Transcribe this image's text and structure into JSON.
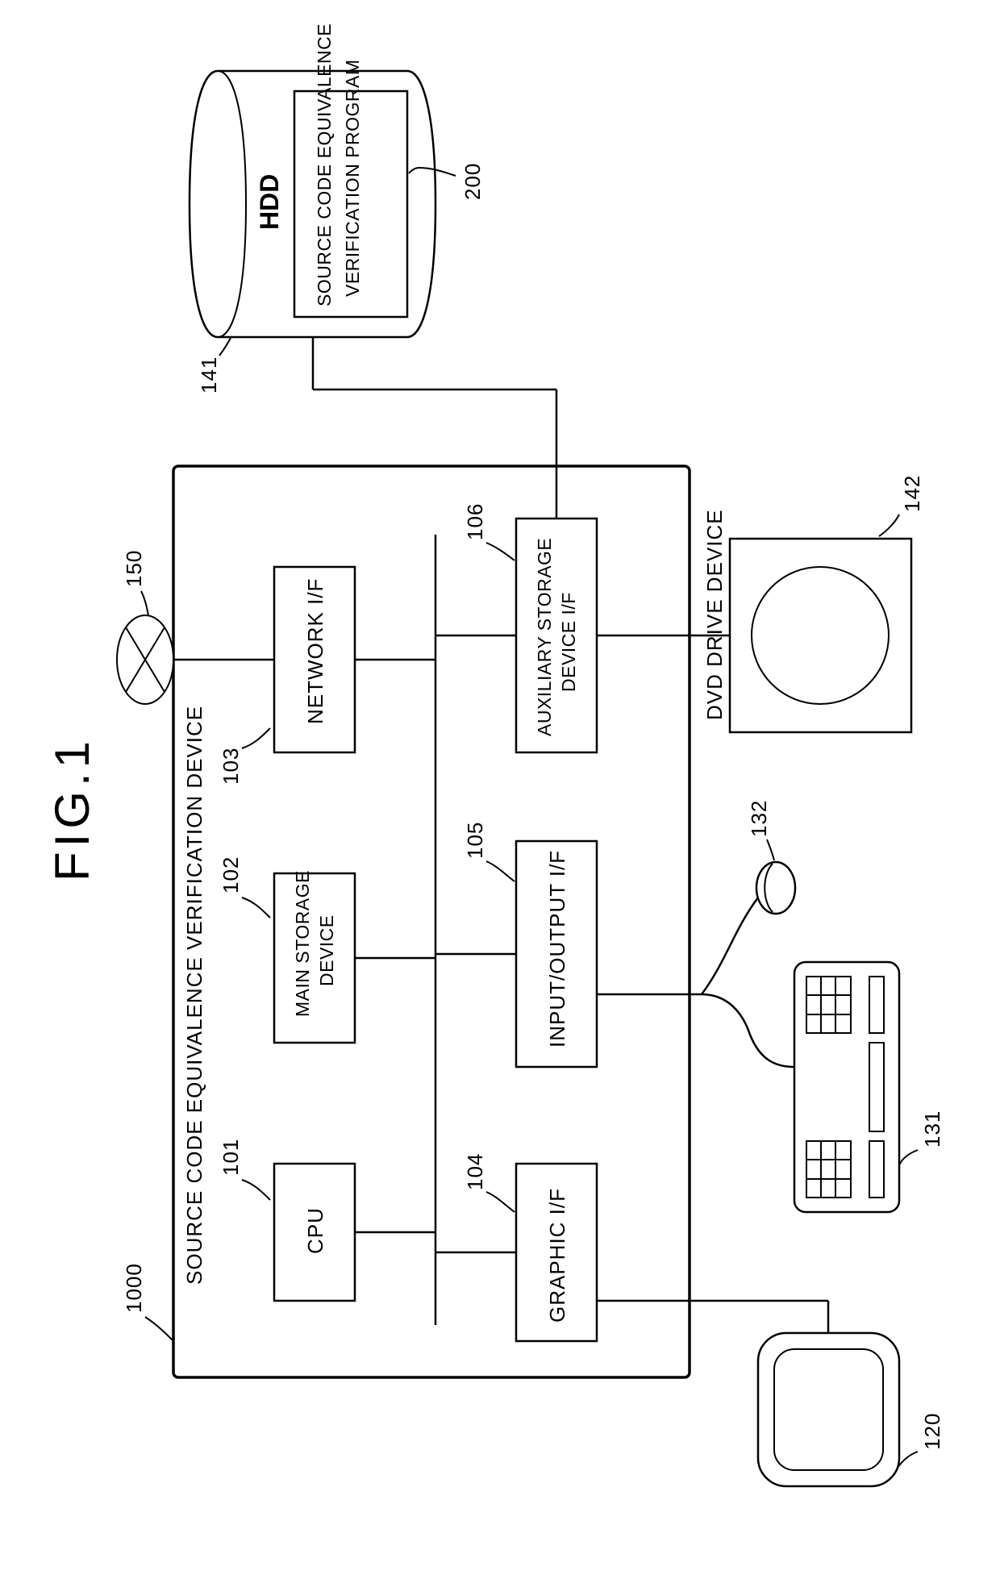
{
  "figure_title": "FIG.1",
  "device_label": "SOURCE CODE EQUIVALENCE VERIFICATION DEVICE",
  "device_ref": "1000",
  "blocks": {
    "cpu": {
      "label": "CPU",
      "ref": "101"
    },
    "main_storage": {
      "label1": "MAIN STORAGE",
      "label2": "DEVICE",
      "ref": "102"
    },
    "network_if": {
      "label": "NETWORK I/F",
      "ref": "103"
    },
    "graphic_if": {
      "label": "GRAPHIC I/F",
      "ref": "104"
    },
    "io_if": {
      "label": "INPUT/OUTPUT I/F",
      "ref": "105"
    },
    "aux_storage": {
      "label1": "AUXILIARY STORAGE",
      "label2": "DEVICE I/F",
      "ref": "106"
    }
  },
  "externals": {
    "monitor_ref": "120",
    "keyboard_ref": "131",
    "mouse_ref": "132",
    "network_ref": "150",
    "dvd": {
      "label": "DVD DRIVE DEVICE",
      "ref": "142"
    },
    "hdd": {
      "label": "HDD",
      "ref": "141",
      "program": {
        "line1": "SOURCE CODE EQUIVALENCE",
        "line2": "VERIFICATION PROGRAM",
        "ref": "200"
      }
    }
  }
}
